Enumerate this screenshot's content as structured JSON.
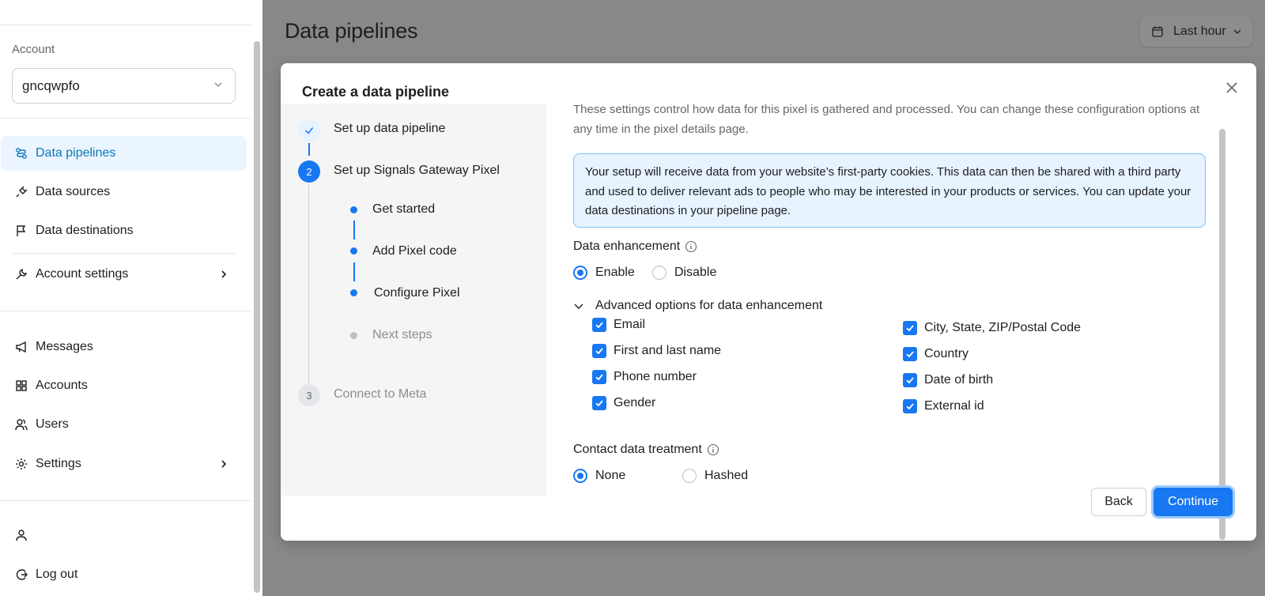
{
  "sidebar": {
    "account_label": "Account",
    "account_value": "gncqwpfo",
    "nav": {
      "data_pipelines": "Data pipelines",
      "data_sources": "Data sources",
      "data_destinations": "Data destinations",
      "account_settings": "Account settings",
      "messages": "Messages",
      "accounts": "Accounts",
      "users": "Users",
      "settings": "Settings",
      "log_out": "Log out"
    }
  },
  "header": {
    "title": "Data pipelines",
    "date_range": "Last hour"
  },
  "modal": {
    "title": "Create a data pipeline",
    "steps": {
      "s1": "Set up data pipeline",
      "s2": "Set up Signals Gateway Pixel",
      "s2_num": "2",
      "sub1": "Get started",
      "sub2": "Add Pixel code",
      "sub3": "Configure Pixel",
      "sub4": "Next steps",
      "s3": "Connect to Meta",
      "s3_num": "3"
    },
    "intro": "These settings control how data for this pixel is gathered and processed. You can change these configuration options at any time in the pixel details page.",
    "info": "Your setup will receive data from your website’s first-party cookies. This data can then be shared with a third party and used to deliver relevant ads to people who may be interested in your products or services. You can update your data destinations in your pipeline page.",
    "enhancement": {
      "label": "Data enhancement",
      "enable": "Enable",
      "disable": "Disable",
      "selected": "Enable",
      "advanced": "Advanced options for data enhancement",
      "left": [
        "Email",
        "First and last name",
        "Phone number",
        "Gender"
      ],
      "right": [
        "City, State, ZIP/Postal Code",
        "Country",
        "Date of birth",
        "External id"
      ]
    },
    "treatment": {
      "label": "Contact data treatment",
      "none": "None",
      "hashed": "Hashed",
      "selected": "None"
    },
    "back": "Back",
    "continue": "Continue"
  }
}
